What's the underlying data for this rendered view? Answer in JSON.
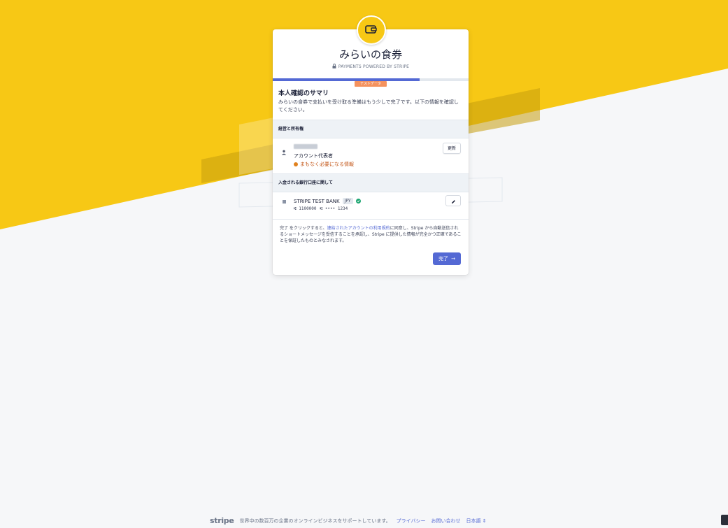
{
  "colors": {
    "brand_yellow": "#f7c815",
    "accent": "#5469d4",
    "warning": "#c4581a",
    "test_badge": "#f5925e",
    "success": "#1ea672"
  },
  "header": {
    "shop_name": "みらいの食券",
    "powered_by": "PAYMENTS POWERED BY STRIPE",
    "logo_icon": "wallet-icon",
    "lock_icon": "lock-icon"
  },
  "progress": {
    "fraction": 0.75
  },
  "test_badge": "テストデータ",
  "summary": {
    "title": "本人確認のサマリ",
    "description": "みらいの食券で支払いを受け取る準備はもう少しで完了です。以下の情報を確認してください。"
  },
  "ownership": {
    "section_title": "経営と所有権",
    "role": "アカウント代表者",
    "warning": "まもなく必要になる情報",
    "update_label": "更新"
  },
  "bank": {
    "section_title": "入金される銀行口座に関して",
    "name": "STRIPE TEST BANK",
    "currency": "JPY",
    "routing": "1100000",
    "account": "•••• 1234"
  },
  "terms": {
    "pre": "完了 をクリックすると、",
    "link": "連結されたアカウントの利用規約",
    "post": "に同意し、Stripe から自動送信されるショートメッセージを受信することを承認し、Stripe に提供した情報が完全かつ正確であることを保証したものとみなされます。"
  },
  "done_label": "完了",
  "footer": {
    "brand": "stripe",
    "tagline": "世界中の数百万の企業のオンラインビジネスをサポートしています。",
    "privacy": "プライバシー",
    "contact": "お問い合わせ",
    "language": "日本語"
  }
}
